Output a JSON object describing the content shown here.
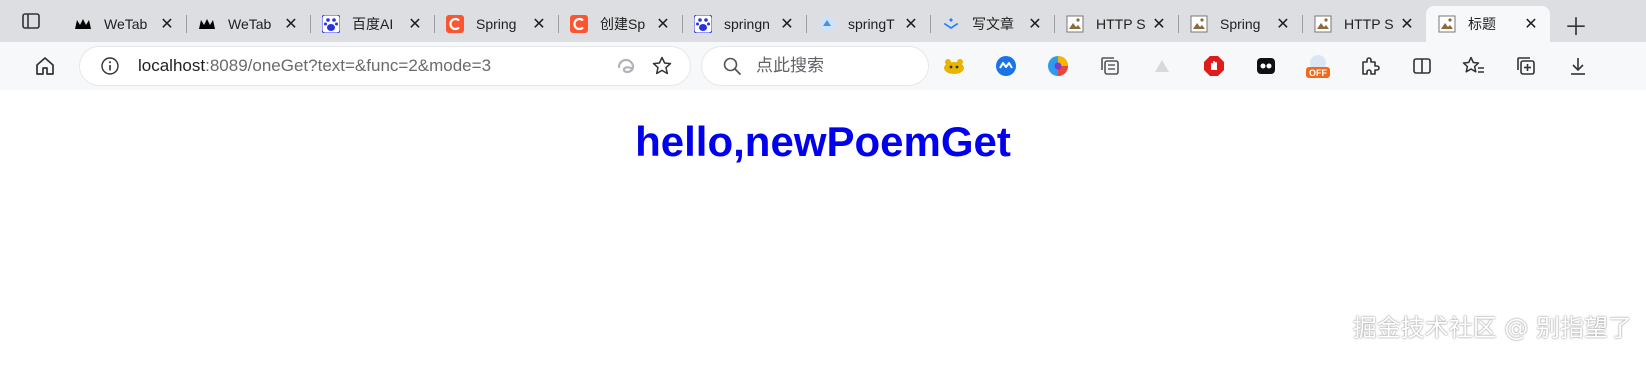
{
  "tabs": [
    {
      "title": "WeTab",
      "favicon": "wetab-logo-icon",
      "color": "#000000",
      "active": false
    },
    {
      "title": "WeTab",
      "favicon": "wetab-logo-icon",
      "color": "#000000",
      "active": false
    },
    {
      "title": "百度AI",
      "favicon": "baidu-paw-icon",
      "color": "#2932e1",
      "active": false
    },
    {
      "title": "Spring",
      "favicon": "csdn-c-icon",
      "color": "#fc5531",
      "active": false
    },
    {
      "title": "创建Sp",
      "favicon": "csdn-c-icon",
      "color": "#fc5531",
      "active": false
    },
    {
      "title": "springn",
      "favicon": "baidu-paw-icon",
      "color": "#2932e1",
      "active": false
    },
    {
      "title": "springT",
      "favicon": "blue-circle-icon",
      "color": "#4a90e2",
      "active": false
    },
    {
      "title": "写文章",
      "favicon": "juejin-logo-icon",
      "color": "#1e80ff",
      "active": false
    },
    {
      "title": "HTTP S",
      "favicon": "broken-image-icon",
      "color": "#8b6b3a",
      "active": false
    },
    {
      "title": "Spring",
      "favicon": "broken-image-icon",
      "color": "#8b6b3a",
      "active": false
    },
    {
      "title": "HTTP S",
      "favicon": "broken-image-icon",
      "color": "#8b6b3a",
      "active": false
    },
    {
      "title": "标题",
      "favicon": "broken-image-icon",
      "color": "#8b6b3a",
      "active": true
    }
  ],
  "address": {
    "host": "localhost",
    "rest": ":8089/oneGet?text=&func=2&mode=3"
  },
  "search": {
    "placeholder": "点此搜索"
  },
  "extensions": [
    "tampermonkey-icon",
    "blue-extension-icon",
    "colorful-ball-icon",
    "collections-icon",
    "gray-triangle-icon",
    "red-stop-icon",
    "black-eyes-icon",
    "off-badge-icon",
    "extensions-puzzle-icon",
    "split-screen-icon",
    "favorites-icon",
    "collections-add-icon",
    "download-icon"
  ],
  "off_badge": "OFF",
  "page": {
    "heading": "hello,newPoemGet"
  },
  "watermark": "掘金技术社区 @ 别指望了"
}
